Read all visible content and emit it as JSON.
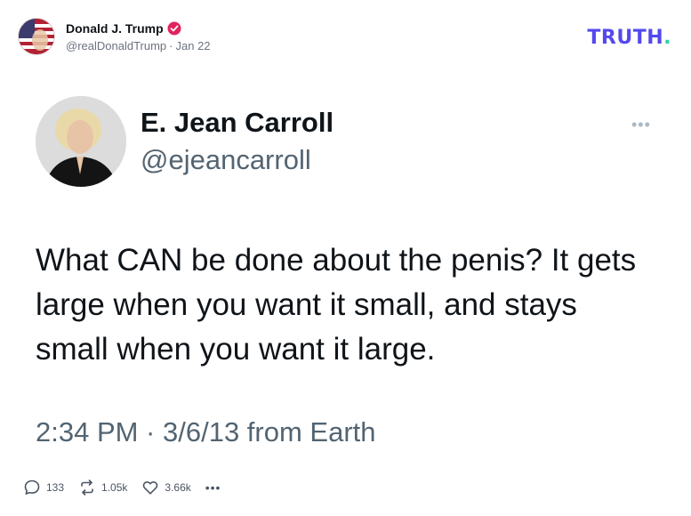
{
  "post": {
    "author_name": "Donald J. Trump",
    "handle": "@realDonaldTrump",
    "separator": "·",
    "date": "Jan 22",
    "verified_icon": "verified-badge-icon"
  },
  "brand": {
    "logo_text": "TRUTH",
    "logo_dot": ".",
    "colors": {
      "logo": "#5448ee",
      "logo_dot": "#2bd4a3"
    }
  },
  "embedded_tweet": {
    "name": "E. Jean Carroll",
    "handle": "@ejeancarroll",
    "more_label": "•••",
    "text": "What CAN be done about the penis? It gets large when you want it small, and stays small when you want it large.",
    "timestamp": "2:34 PM · 3/6/13 from Earth"
  },
  "actions": {
    "replies": "133",
    "retruths": "1.05k",
    "likes": "3.66k",
    "more_label": "•••"
  }
}
